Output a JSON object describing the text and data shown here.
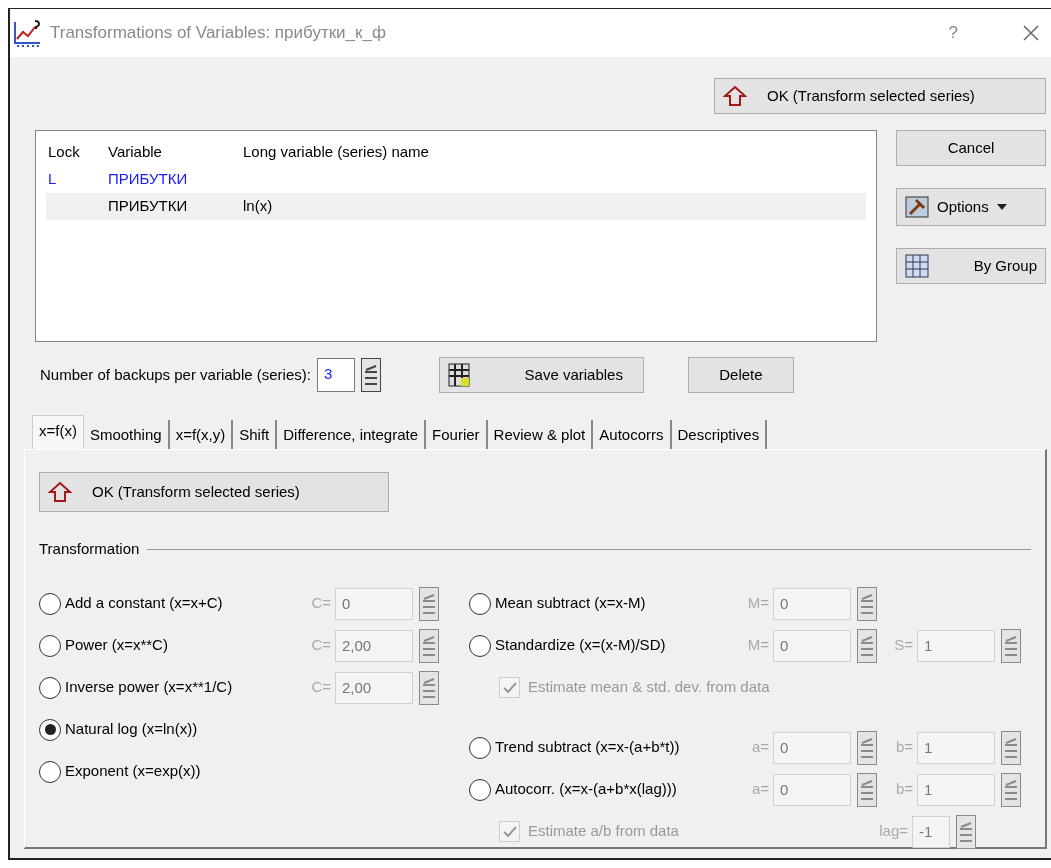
{
  "window": {
    "title": "Transformations of Variables: прибутки_к_ф",
    "help": "?"
  },
  "ok_top": "OK (Transform selected series)",
  "list": {
    "columns": [
      "Lock",
      "Variable",
      "Long variable (series) name"
    ],
    "rows": [
      {
        "lock": "L",
        "variable": "ПРИБУТКИ",
        "long_name": "",
        "locked": true,
        "selected": false
      },
      {
        "lock": "",
        "variable": "ПРИБУТКИ",
        "long_name": "ln(x)",
        "locked": false,
        "selected": true
      }
    ]
  },
  "side_buttons": [
    {
      "label": "Cancel",
      "kind": "plain"
    },
    {
      "label": "Options",
      "kind": "menu"
    },
    {
      "label": "By Group",
      "kind": "group"
    }
  ],
  "backups": {
    "label": "Number of backups per variable (series):",
    "value": "3"
  },
  "save_button": "Save variables",
  "delete_button": "Delete",
  "tabs": [
    {
      "label": "x=f(x)",
      "selected": true
    },
    {
      "label": "Smoothing",
      "selected": false
    },
    {
      "label": "x=f(x,y)",
      "selected": false
    },
    {
      "label": "Shift",
      "selected": false
    },
    {
      "label": "Difference, integrate",
      "selected": false
    },
    {
      "label": "Fourier",
      "selected": false
    },
    {
      "label": "Review & plot",
      "selected": false
    },
    {
      "label": "Autocorrs",
      "selected": false
    },
    {
      "label": "Descriptives",
      "selected": false
    }
  ],
  "panel_ok": "OK (Transform selected series)",
  "group_label": "Transformation",
  "left_options": [
    {
      "kind": "radio",
      "label": "Add a constant (x=x+C)",
      "selected": false,
      "params": [
        {
          "label": "C=",
          "value": "0"
        }
      ]
    },
    {
      "kind": "radio",
      "label": "Power (x=x**C)",
      "selected": false,
      "params": [
        {
          "label": "C=",
          "value": "2,00"
        }
      ]
    },
    {
      "kind": "radio",
      "label": "Inverse power (x=x**1/C)",
      "selected": false,
      "params": [
        {
          "label": "C=",
          "value": "2,00"
        }
      ]
    },
    {
      "kind": "radio",
      "label": "Natural log (x=ln(x))",
      "selected": true
    },
    {
      "kind": "radio",
      "label": "Exponent (x=exp(x))",
      "selected": false
    }
  ],
  "right_options": [
    {
      "kind": "radio",
      "label": "Mean subtract (x=x-M)",
      "selected": false,
      "params": [
        {
          "label": "M=",
          "value": "0"
        }
      ]
    },
    {
      "kind": "radio",
      "label": "Standardize (x=(x-M)/SD)",
      "selected": false,
      "params": [
        {
          "label": "M=",
          "value": "0"
        },
        {
          "label": "S=",
          "value": "1"
        }
      ]
    },
    {
      "kind": "checkbox",
      "label": "Estimate mean & std. dev. from data",
      "checked": true,
      "disabled": true
    },
    {
      "kind": "gap"
    },
    {
      "kind": "radio",
      "label": "Trend subtract (x=x-(a+b*t))",
      "selected": false,
      "params": [
        {
          "label": "a=",
          "value": "0"
        },
        {
          "label": "b=",
          "value": "1"
        }
      ]
    },
    {
      "kind": "radio",
      "label": "Autocorr. (x=x-(a+b*x(lag)))",
      "selected": false,
      "params": [
        {
          "label": "a=",
          "value": "0"
        },
        {
          "label": "b=",
          "value": "1"
        }
      ]
    },
    {
      "kind": "checkbox",
      "label": "Estimate a/b from data",
      "checked": true,
      "disabled": true,
      "params": [
        {
          "label": "lag=",
          "value": "-1"
        }
      ]
    }
  ]
}
